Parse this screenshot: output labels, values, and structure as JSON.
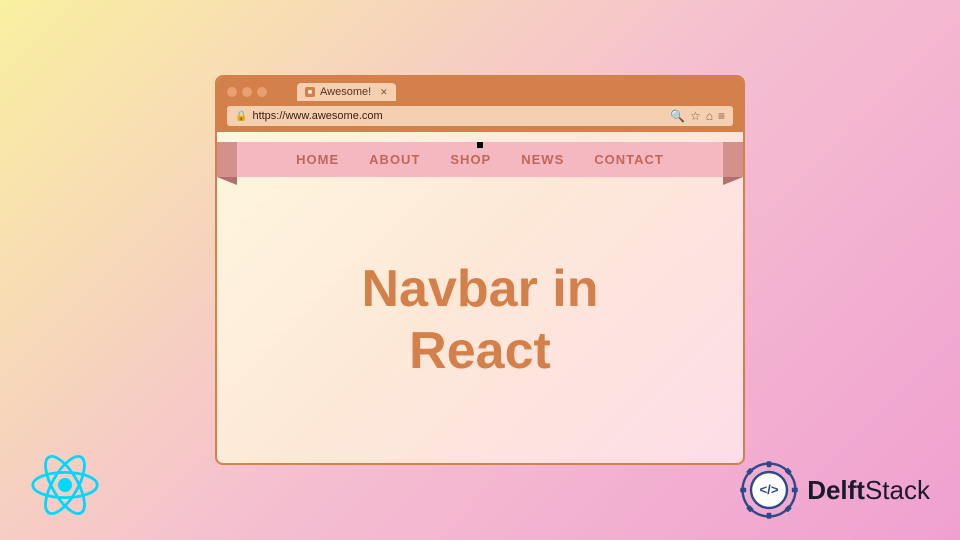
{
  "background": {
    "gradient_start": "#f9f0a0",
    "gradient_end": "#f0a0d0"
  },
  "browser": {
    "tab_title": "Awesome!",
    "address_url": "https://www.awesome.com",
    "dots": [
      "dot1",
      "dot2",
      "dot3"
    ]
  },
  "navbar": {
    "items": [
      {
        "id": "home",
        "label": "HOME"
      },
      {
        "id": "about",
        "label": "ABOUT"
      },
      {
        "id": "shop",
        "label": "SHOP"
      },
      {
        "id": "news",
        "label": "NEWS"
      },
      {
        "id": "contact",
        "label": "CONTACT"
      }
    ]
  },
  "main_content": {
    "title_line1": "Navbar in",
    "title_line2": "React"
  },
  "logos": {
    "react": "React Logo",
    "delft_text_bold": "Delft",
    "delft_text_regular": "Stack"
  }
}
